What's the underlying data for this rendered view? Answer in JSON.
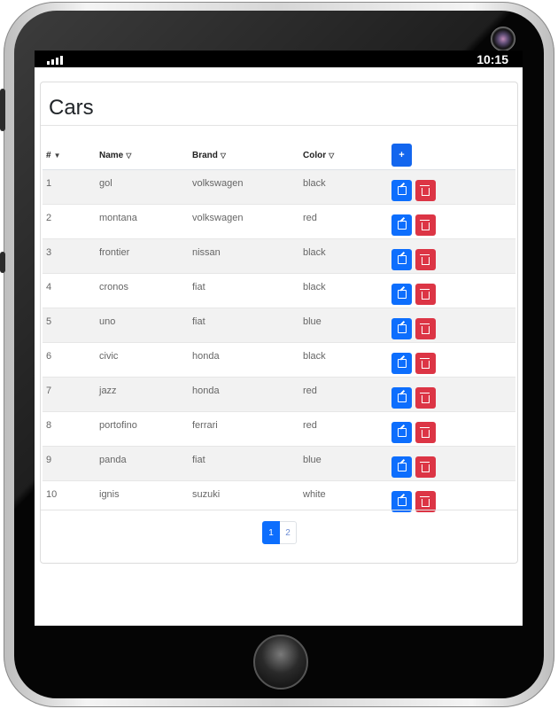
{
  "status_bar": {
    "time": "10:15"
  },
  "card": {
    "title": "Cars"
  },
  "table": {
    "headers": [
      {
        "label": "#",
        "sort_icon": "▼"
      },
      {
        "label": "Name",
        "sort_icon": "▽"
      },
      {
        "label": "Brand",
        "sort_icon": "▽"
      },
      {
        "label": "Color",
        "sort_icon": "▽"
      }
    ],
    "add_button_label": "+",
    "rows": [
      {
        "id": "1",
        "name": "gol",
        "brand": "volkswagen",
        "color": "black"
      },
      {
        "id": "2",
        "name": "montana",
        "brand": "volkswagen",
        "color": "red"
      },
      {
        "id": "3",
        "name": "frontier",
        "brand": "nissan",
        "color": "black"
      },
      {
        "id": "4",
        "name": "cronos",
        "brand": "fiat",
        "color": "black"
      },
      {
        "id": "5",
        "name": "uno",
        "brand": "fiat",
        "color": "blue"
      },
      {
        "id": "6",
        "name": "civic",
        "brand": "honda",
        "color": "black"
      },
      {
        "id": "7",
        "name": "jazz",
        "brand": "honda",
        "color": "red"
      },
      {
        "id": "8",
        "name": "portofino",
        "brand": "ferrari",
        "color": "red"
      },
      {
        "id": "9",
        "name": "panda",
        "brand": "fiat",
        "color": "blue"
      },
      {
        "id": "10",
        "name": "ignis",
        "brand": "suzuki",
        "color": "white"
      }
    ]
  },
  "pagination": {
    "pages": [
      "1",
      "2"
    ],
    "current": "1"
  },
  "colors": {
    "primary": "#0d6efd",
    "danger": "#dc3545",
    "stripe": "#f2f2f2"
  },
  "icons": {
    "edit": "edit-icon",
    "delete": "trash-icon",
    "signal": "signal-icon"
  }
}
